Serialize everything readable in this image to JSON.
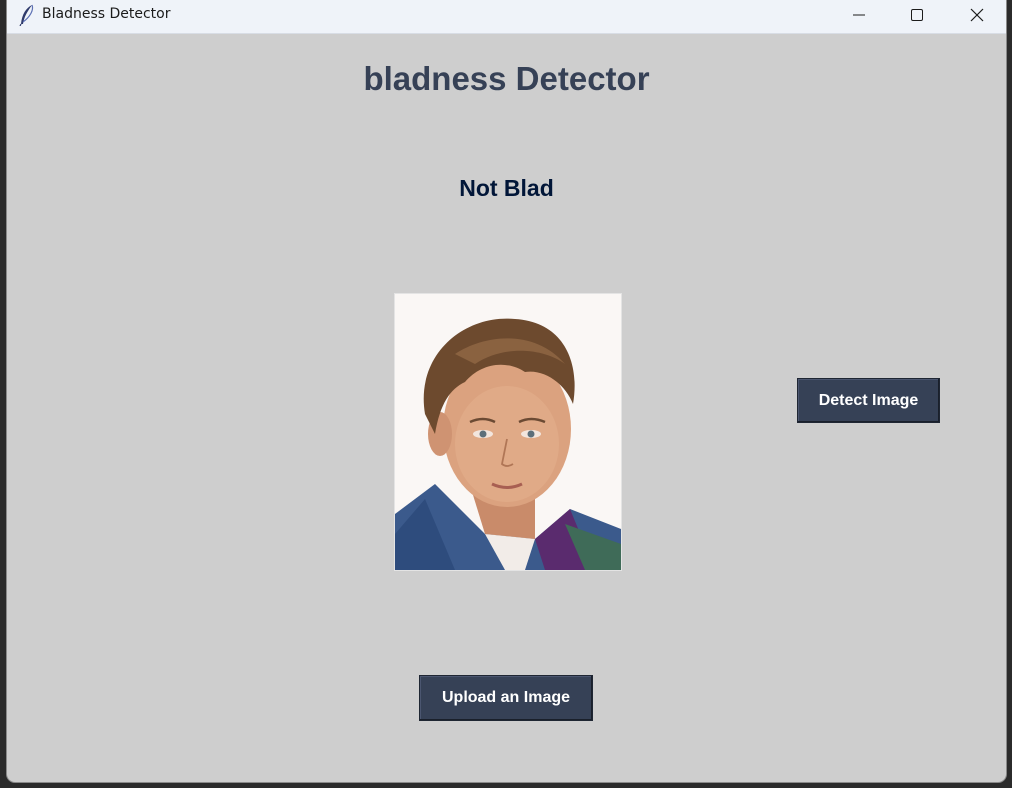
{
  "window": {
    "title": "Bladness Detector",
    "controls": {
      "minimize_icon": "minimize-icon",
      "maximize_icon": "maximize-icon",
      "close_icon": "close-icon"
    }
  },
  "main": {
    "heading": "bladness Detector",
    "result_label": "Not Blad",
    "image_subject": "portrait-photo",
    "detect_button_label": "Detect Image",
    "upload_button_label": "Upload an Image"
  },
  "colors": {
    "background": "#cecece",
    "heading": "#364156",
    "result": "#011638",
    "button_bg": "#364156",
    "button_text": "#ffffff"
  }
}
